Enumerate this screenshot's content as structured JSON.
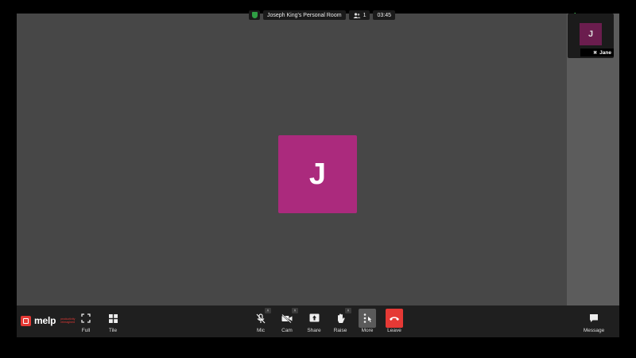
{
  "meeting": {
    "room_name": "Joseph King's Personal Room",
    "participant_count": "1",
    "elapsed_time": "03:45"
  },
  "main_speaker": {
    "initial": "J",
    "tile_color": "#ab2a7d"
  },
  "self_view": {
    "initial": "J",
    "name": "Jane"
  },
  "brand": {
    "name": "melp",
    "tagline": "productivity reimagined"
  },
  "toolbar": {
    "full_label": "Full",
    "tile_label": "Tile",
    "mic_label": "Mic",
    "cam_label": "Cam",
    "share_label": "Share",
    "raise_label": "Raise",
    "more_label": "More",
    "leave_label": "Leave",
    "message_label": "Message"
  },
  "colors": {
    "leave": "#e53935",
    "brand": "#e53935",
    "secure": "#2f9e44"
  }
}
